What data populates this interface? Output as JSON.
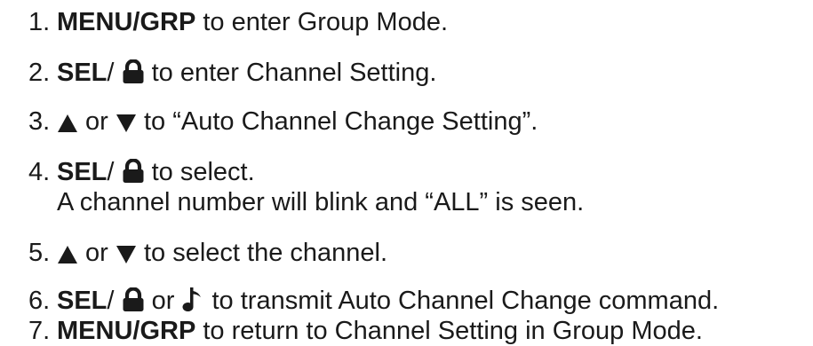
{
  "steps": [
    {
      "num": "1.",
      "key": "MENU/GRP",
      "text": " to enter Group Mode."
    },
    {
      "num": "2.",
      "key": "SEL",
      "slash": "/ ",
      "text": " to enter Channel Setting."
    },
    {
      "num": "3.",
      "or": " or ",
      "text": " to “Auto Channel Change Setting”."
    },
    {
      "num": "4.",
      "key": "SEL",
      "slash": "/ ",
      "text": " to select.",
      "sub": "A channel number will blink and “ALL” is seen."
    },
    {
      "num": "5.",
      "or": " or ",
      "text": " to select the channel."
    },
    {
      "num": "6.",
      "key": "SEL",
      "slash": "/ ",
      "or": " or ",
      "text": " to transmit Auto Channel Change command."
    },
    {
      "num": "7.",
      "key": "MENU/GRP",
      "text": " to return to Channel Setting in Group Mode."
    }
  ],
  "icons": {
    "lock": "lock-icon",
    "up": "up-triangle-icon",
    "down": "down-triangle-icon",
    "note": "music-note-icon"
  },
  "colors": {
    "text": "#1a1a1a"
  }
}
